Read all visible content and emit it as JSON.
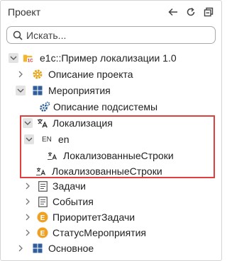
{
  "header": {
    "title": "Проект"
  },
  "search": {
    "placeholder": "Искать..."
  },
  "tree": {
    "root": {
      "label": "e1c::Пример локализации 1.0",
      "badge": "1C"
    },
    "project_description": {
      "label": "Описание проекта"
    },
    "events_subsystem": {
      "label": "Мероприятия"
    },
    "subsystem_description": {
      "label": "Описание подсистемы"
    },
    "localization": {
      "label": "Локализация"
    },
    "lang_en": {
      "prefix": "EN",
      "label": "en"
    },
    "en_strings": {
      "label": "ЛокализованныеСтроки"
    },
    "strings": {
      "label": "ЛокализованныеСтроки"
    },
    "tasks": {
      "label": "Задачи"
    },
    "events": {
      "label": "События"
    },
    "task_priority": {
      "label": "ПриоритетЗадачи",
      "badge": "E"
    },
    "event_status": {
      "label": "СтатусМероприятия",
      "badge": "E"
    },
    "main": {
      "label": "Основное"
    }
  },
  "colors": {
    "enum_badge": "#f0a023",
    "gear": "#e8a317",
    "grid_icon": "#2f5f9a",
    "highlight_border": "#e0403c",
    "folder": "#f2b631",
    "root_badge": "#d8272d"
  }
}
